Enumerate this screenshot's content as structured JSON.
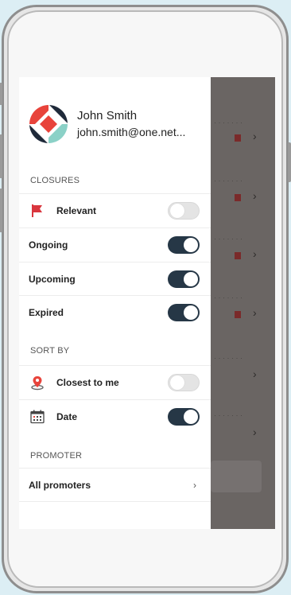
{
  "user": {
    "name": "John Smith",
    "email": "john.smith@one.net..."
  },
  "closures": {
    "heading": "CLOSURES",
    "items": [
      {
        "label": "Relevant",
        "icon": "flag-icon",
        "on": false
      },
      {
        "label": "Ongoing",
        "on": true
      },
      {
        "label": "Upcoming",
        "on": true
      },
      {
        "label": "Expired",
        "on": true
      }
    ]
  },
  "sort_by": {
    "heading": "SORT BY",
    "items": [
      {
        "label": "Closest to me",
        "icon": "location-pin-icon",
        "on": false
      },
      {
        "label": "Date",
        "icon": "calendar-icon",
        "on": true
      }
    ]
  },
  "promoter": {
    "heading": "PROMOTER",
    "item_label": "All promoters",
    "chevron": "›"
  },
  "colors": {
    "toggle_on": "#263746",
    "flag": "#d9363e",
    "backdrop": "#6a6563"
  }
}
